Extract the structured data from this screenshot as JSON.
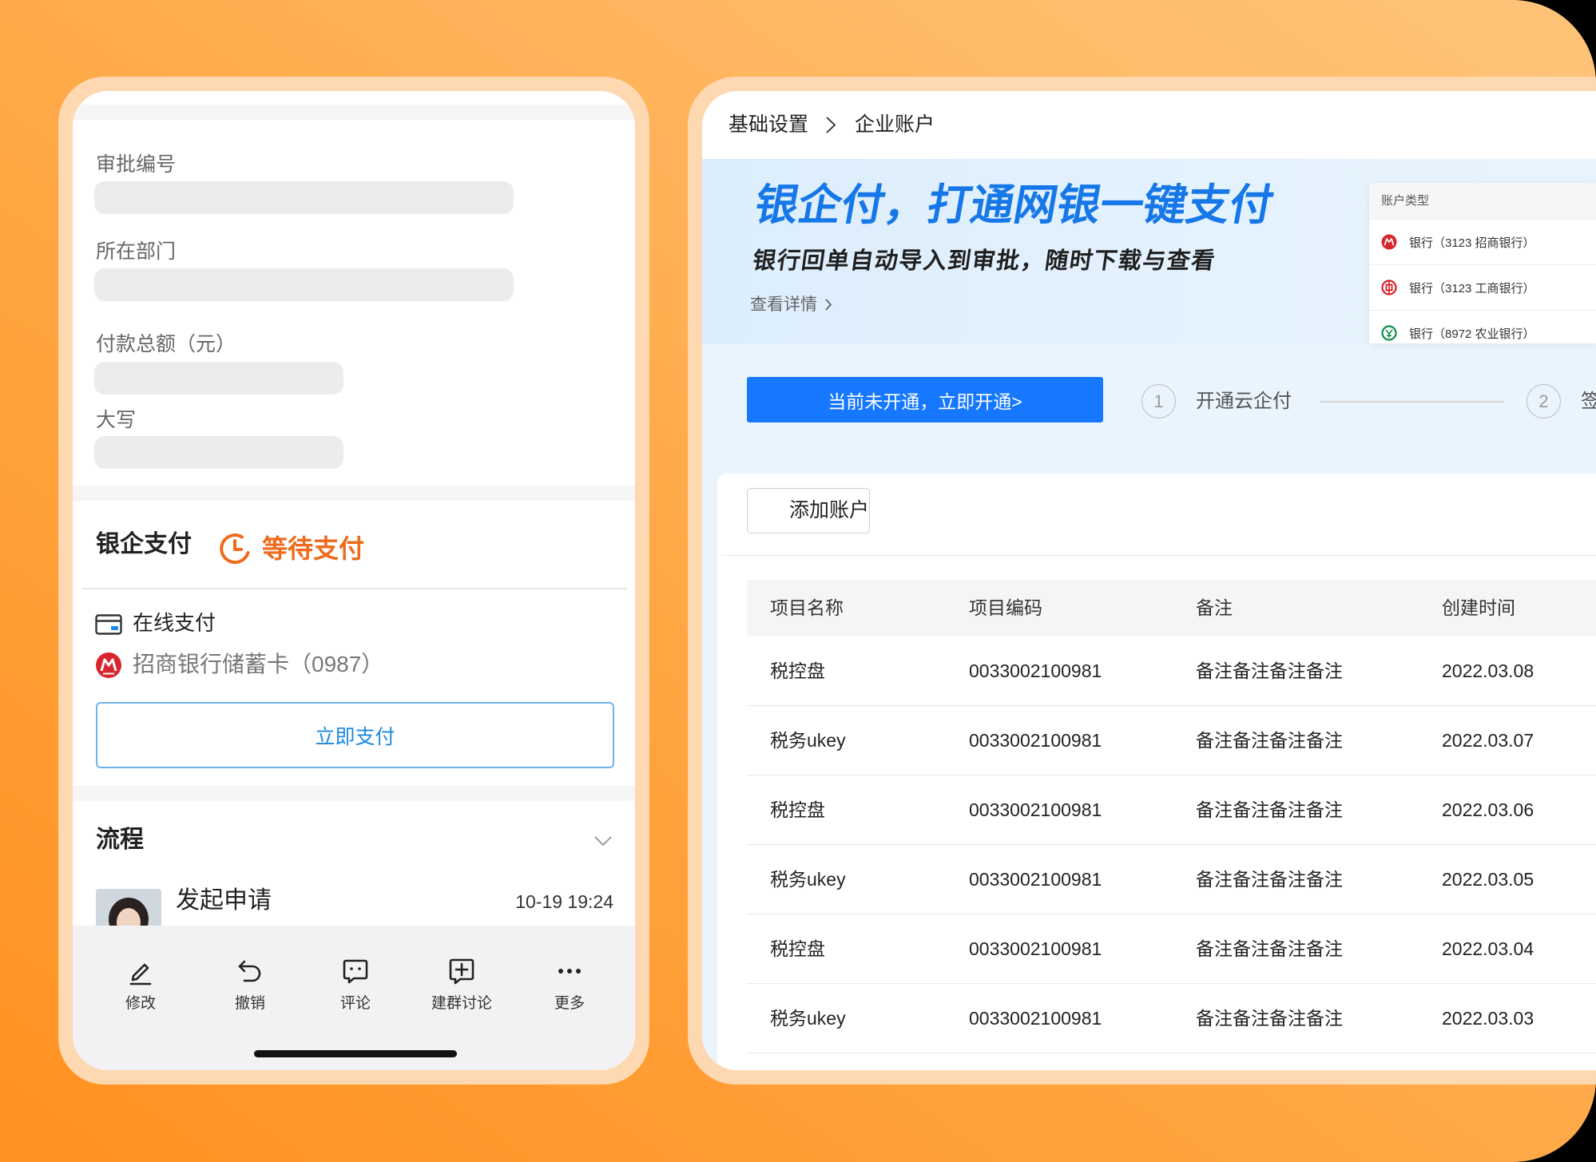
{
  "phone": {
    "fields": [
      {
        "label": "审批编号"
      },
      {
        "label": "所在部门"
      },
      {
        "label": "付款总额（元）"
      },
      {
        "label": "大写"
      }
    ],
    "payment": {
      "title": "银企支付",
      "status": "等待支付",
      "status_icon": "clock-icon",
      "method": "在线支付",
      "method_icon": "card-icon",
      "card": "招商银行储蓄卡（0987）",
      "card_icon": "cmb-logo-icon",
      "pay_button": "立即支付"
    },
    "process": {
      "title": "流程",
      "toggle_icon": "chevron-down-icon",
      "step_name": "发起申请",
      "step_time": "10-19 19:24"
    },
    "toolbar": [
      {
        "label": "修改",
        "icon": "pencil-icon"
      },
      {
        "label": "撤销",
        "icon": "undo-icon"
      },
      {
        "label": "评论",
        "icon": "comment-icon"
      },
      {
        "label": "建群讨论",
        "icon": "group-chat-add-icon"
      },
      {
        "label": "更多",
        "icon": "more-dots-icon"
      }
    ]
  },
  "web": {
    "breadcrumb": [
      "基础设置",
      "企业账户"
    ],
    "banner": {
      "title": "银企付，打通网银一键支付",
      "subtitle": "银行回单自动导入到审批，随时下载与查看",
      "link": "查看详情"
    },
    "account_types": {
      "header": "账户类型",
      "options": [
        {
          "label": "银行（3123 招商银行）",
          "icon": "cmb-logo-icon"
        },
        {
          "label": "银行（3123 工商银行）",
          "icon": "icbc-logo-icon"
        },
        {
          "label": "银行（8972 农业银行）",
          "icon": "abc-logo-icon"
        }
      ]
    },
    "activate_button": "当前未开通，立即开通>",
    "steps": [
      {
        "number": "1",
        "label": "开通云企付"
      },
      {
        "number": "2",
        "label": "签"
      }
    ],
    "add_account_button": "添加账户",
    "table": {
      "columns": [
        "项目名称",
        "项目编码",
        "备注",
        "创建时间"
      ],
      "rows": [
        {
          "name": "税控盘",
          "code": "0033002100981",
          "note": "备注备注备注备注",
          "date": "2022.03.08"
        },
        {
          "name": "税务ukey",
          "code": "0033002100981",
          "note": "备注备注备注备注",
          "date": "2022.03.07"
        },
        {
          "name": "税控盘",
          "code": "0033002100981",
          "note": "备注备注备注备注",
          "date": "2022.03.06"
        },
        {
          "name": "税务ukey",
          "code": "0033002100981",
          "note": "备注备注备注备注",
          "date": "2022.03.05"
        },
        {
          "name": "税控盘",
          "code": "0033002100981",
          "note": "备注备注备注备注",
          "date": "2022.03.04"
        },
        {
          "name": "税务ukey",
          "code": "0033002100981",
          "note": "备注备注备注备注",
          "date": "2022.03.03"
        }
      ]
    }
  },
  "colors": {
    "background_orange": "#ff9f3a",
    "primary_blue": "#1677ff",
    "banner_title_blue": "#1677e8",
    "status_orange": "#ee6a1c",
    "bank_red": "#d8262f",
    "bank_green": "#0a8b4a"
  }
}
